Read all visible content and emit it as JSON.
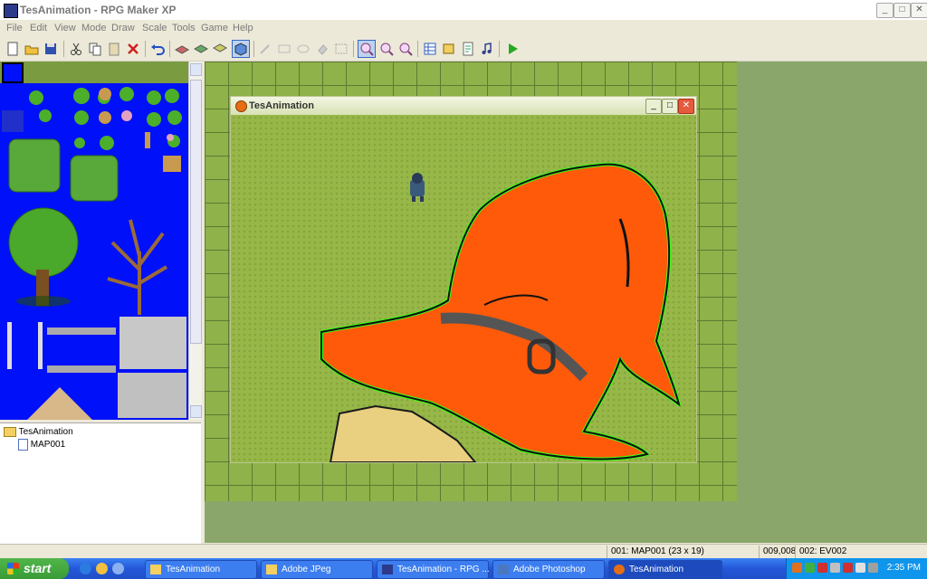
{
  "window": {
    "title": "TesAnimation - RPG Maker XP"
  },
  "menu": [
    "File",
    "Edit",
    "View",
    "Mode",
    "Draw",
    "Scale",
    "Tools",
    "Game",
    "Help"
  ],
  "toolbar_icons": [
    "new-project-icon",
    "open-project-icon",
    "save-icon",
    "cut-icon",
    "copy-icon",
    "paste-icon",
    "delete-icon",
    "undo-icon",
    "layer1-icon",
    "layer2-icon",
    "layer3-icon",
    "events-layer-icon",
    "pencil-icon",
    "rectangle-icon",
    "ellipse-icon",
    "flood-fill-icon",
    "select-icon",
    "zoom-1-icon",
    "zoom-2-icon",
    "zoom-4-icon",
    "database-icon",
    "materialbase-icon",
    "script-editor-icon",
    "sound-test-icon",
    "playtest-icon"
  ],
  "map_tree": {
    "project": "TesAnimation",
    "maps": [
      "MAP001"
    ]
  },
  "game_window": {
    "title": "TesAnimation"
  },
  "status_bar": {
    "map": "001: MAP001 (23 x 19)",
    "coords": "009,008",
    "event": "002: EV002"
  },
  "taskbar": {
    "start": "start",
    "items": [
      {
        "label": "TesAnimation"
      },
      {
        "label": "Adobe JPeg"
      },
      {
        "label": "TesAnimation - RPG ..."
      },
      {
        "label": "Adobe Photoshop"
      },
      {
        "label": "TesAnimation"
      }
    ],
    "clock": "2:35 PM"
  },
  "colors": {
    "map_grass": "#8fb24a",
    "tileset_bg": "#0010f8",
    "hat": "#ff5a0a",
    "taskbar": "#245edc"
  }
}
